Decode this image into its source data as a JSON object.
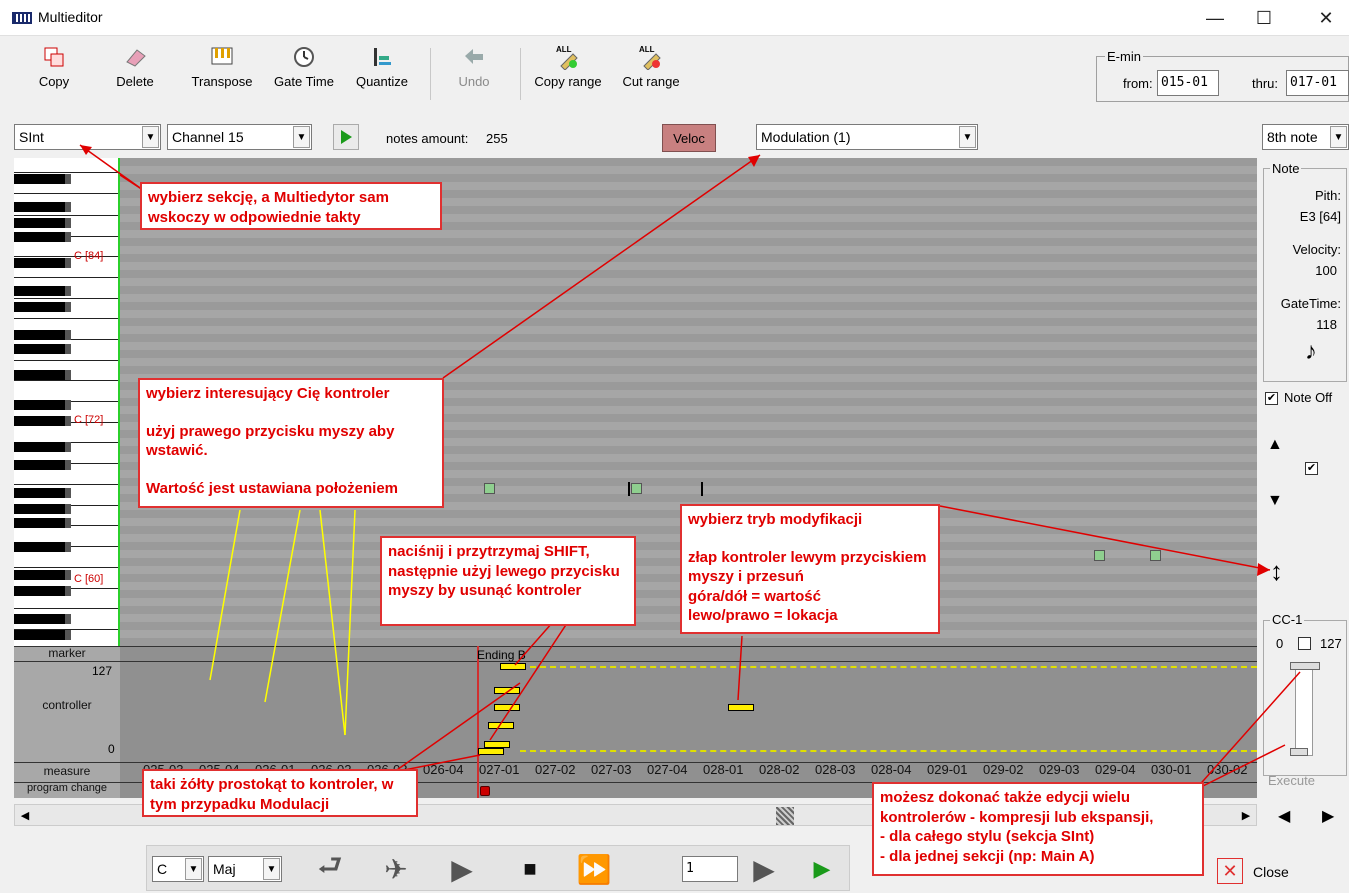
{
  "window": {
    "title": "Multieditor",
    "minimize": "—",
    "maximize": "☐",
    "close": "✕"
  },
  "toolbar": {
    "copy": "Copy",
    "delete": "Delete",
    "transpose": "Transpose",
    "gate_time": "Gate Time",
    "quantize": "Quantize",
    "undo": "Undo",
    "copy_range": "Copy range",
    "cut_range": "Cut range",
    "all_badge": "ALL"
  },
  "emin": {
    "title": "E-min",
    "from_label": "from:",
    "from_value": "015-01",
    "thru_label": "thru:",
    "thru_value": "017-01"
  },
  "controls": {
    "section": "SInt",
    "channel": "Channel 15",
    "notes_amount_label": "notes amount:",
    "notes_amount": "255",
    "veloc": "Veloc",
    "controller": "Modulation (1)",
    "resolution": "8th note"
  },
  "keyboard_labels": [
    "C [84]",
    "C [72]",
    "C [60]"
  ],
  "lanes": {
    "marker": "marker",
    "controller": "controller",
    "measure": "measure",
    "program_change": "program change",
    "max": "127",
    "min": "0",
    "ending": "Ending B"
  },
  "measures": [
    "025-03",
    "025-04",
    "026-01",
    "026-02",
    "026-03",
    "026-04",
    "027-01",
    "027-02",
    "027-03",
    "027-04",
    "028-01",
    "028-02",
    "028-03",
    "028-04",
    "029-01",
    "029-02",
    "029-03",
    "029-04",
    "030-01",
    "030-02"
  ],
  "note_panel": {
    "title": "Note",
    "pitch_label": "Pith:",
    "pitch": "E3 [64]",
    "velocity_label": "Velocity:",
    "velocity": "100",
    "gatetime_label": "GateTime:",
    "gatetime": "118",
    "noteoff": "Note Off"
  },
  "cc_panel": {
    "title": "CC-1",
    "min": "0",
    "max": "127",
    "execute": "Execute"
  },
  "bottom": {
    "key": "C",
    "scale": "Maj",
    "position": "1",
    "close": "Close"
  },
  "annotations": {
    "a1": "wybierz sekcję, a Multiedytor sam wskoczy w odpowiednie takty",
    "a2_l1": "wybierz interesujący Cię kontroler",
    "a2_l2": "użyj prawego przycisku myszy aby wstawić.",
    "a2_l3": "Wartość jest ustawiana położeniem",
    "a3": "naciśnij i przytrzymaj SHIFT, następnie użyj lewego przycisku myszy by usunąć kontroler",
    "a4_l1": "wybierz tryb modyfikacji",
    "a4_l2": "złap kontroler lewym przyciskiem myszy i przesuń",
    "a4_l3": "góra/dół = wartość",
    "a4_l4": "lewo/prawo = lokacja",
    "a5": "taki żółty prostokąt to kontroler, w tym przypadku Modulacji",
    "a6_l1": "możesz dokonać także edycji wielu kontrolerów - kompresji lub ekspansji,",
    "a6_l2": "- dla całego stylu (sekcja SInt)",
    "a6_l3": "- dla jednej sekcji (np: Main A)"
  },
  "colors": {
    "annotation": "#e00000",
    "controller_bar": "#ffef00",
    "bar_line": "#d03030",
    "beat_line": "#2a4fd0"
  }
}
